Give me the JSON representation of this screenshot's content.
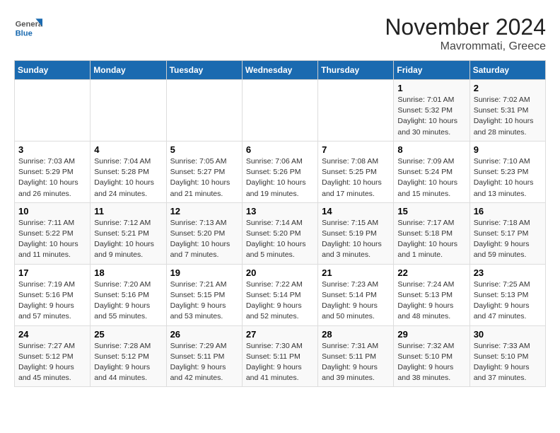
{
  "header": {
    "logo_line1": "General",
    "logo_line2": "Blue",
    "title": "November 2024",
    "subtitle": "Mavrommati, Greece"
  },
  "weekdays": [
    "Sunday",
    "Monday",
    "Tuesday",
    "Wednesday",
    "Thursday",
    "Friday",
    "Saturday"
  ],
  "weeks": [
    [
      {
        "day": "",
        "info": ""
      },
      {
        "day": "",
        "info": ""
      },
      {
        "day": "",
        "info": ""
      },
      {
        "day": "",
        "info": ""
      },
      {
        "day": "",
        "info": ""
      },
      {
        "day": "1",
        "info": "Sunrise: 7:01 AM\nSunset: 5:32 PM\nDaylight: 10 hours\nand 30 minutes."
      },
      {
        "day": "2",
        "info": "Sunrise: 7:02 AM\nSunset: 5:31 PM\nDaylight: 10 hours\nand 28 minutes."
      }
    ],
    [
      {
        "day": "3",
        "info": "Sunrise: 7:03 AM\nSunset: 5:29 PM\nDaylight: 10 hours\nand 26 minutes."
      },
      {
        "day": "4",
        "info": "Sunrise: 7:04 AM\nSunset: 5:28 PM\nDaylight: 10 hours\nand 24 minutes."
      },
      {
        "day": "5",
        "info": "Sunrise: 7:05 AM\nSunset: 5:27 PM\nDaylight: 10 hours\nand 21 minutes."
      },
      {
        "day": "6",
        "info": "Sunrise: 7:06 AM\nSunset: 5:26 PM\nDaylight: 10 hours\nand 19 minutes."
      },
      {
        "day": "7",
        "info": "Sunrise: 7:08 AM\nSunset: 5:25 PM\nDaylight: 10 hours\nand 17 minutes."
      },
      {
        "day": "8",
        "info": "Sunrise: 7:09 AM\nSunset: 5:24 PM\nDaylight: 10 hours\nand 15 minutes."
      },
      {
        "day": "9",
        "info": "Sunrise: 7:10 AM\nSunset: 5:23 PM\nDaylight: 10 hours\nand 13 minutes."
      }
    ],
    [
      {
        "day": "10",
        "info": "Sunrise: 7:11 AM\nSunset: 5:22 PM\nDaylight: 10 hours\nand 11 minutes."
      },
      {
        "day": "11",
        "info": "Sunrise: 7:12 AM\nSunset: 5:21 PM\nDaylight: 10 hours\nand 9 minutes."
      },
      {
        "day": "12",
        "info": "Sunrise: 7:13 AM\nSunset: 5:20 PM\nDaylight: 10 hours\nand 7 minutes."
      },
      {
        "day": "13",
        "info": "Sunrise: 7:14 AM\nSunset: 5:20 PM\nDaylight: 10 hours\nand 5 minutes."
      },
      {
        "day": "14",
        "info": "Sunrise: 7:15 AM\nSunset: 5:19 PM\nDaylight: 10 hours\nand 3 minutes."
      },
      {
        "day": "15",
        "info": "Sunrise: 7:17 AM\nSunset: 5:18 PM\nDaylight: 10 hours\nand 1 minute."
      },
      {
        "day": "16",
        "info": "Sunrise: 7:18 AM\nSunset: 5:17 PM\nDaylight: 9 hours\nand 59 minutes."
      }
    ],
    [
      {
        "day": "17",
        "info": "Sunrise: 7:19 AM\nSunset: 5:16 PM\nDaylight: 9 hours\nand 57 minutes."
      },
      {
        "day": "18",
        "info": "Sunrise: 7:20 AM\nSunset: 5:16 PM\nDaylight: 9 hours\nand 55 minutes."
      },
      {
        "day": "19",
        "info": "Sunrise: 7:21 AM\nSunset: 5:15 PM\nDaylight: 9 hours\nand 53 minutes."
      },
      {
        "day": "20",
        "info": "Sunrise: 7:22 AM\nSunset: 5:14 PM\nDaylight: 9 hours\nand 52 minutes."
      },
      {
        "day": "21",
        "info": "Sunrise: 7:23 AM\nSunset: 5:14 PM\nDaylight: 9 hours\nand 50 minutes."
      },
      {
        "day": "22",
        "info": "Sunrise: 7:24 AM\nSunset: 5:13 PM\nDaylight: 9 hours\nand 48 minutes."
      },
      {
        "day": "23",
        "info": "Sunrise: 7:25 AM\nSunset: 5:13 PM\nDaylight: 9 hours\nand 47 minutes."
      }
    ],
    [
      {
        "day": "24",
        "info": "Sunrise: 7:27 AM\nSunset: 5:12 PM\nDaylight: 9 hours\nand 45 minutes."
      },
      {
        "day": "25",
        "info": "Sunrise: 7:28 AM\nSunset: 5:12 PM\nDaylight: 9 hours\nand 44 minutes."
      },
      {
        "day": "26",
        "info": "Sunrise: 7:29 AM\nSunset: 5:11 PM\nDaylight: 9 hours\nand 42 minutes."
      },
      {
        "day": "27",
        "info": "Sunrise: 7:30 AM\nSunset: 5:11 PM\nDaylight: 9 hours\nand 41 minutes."
      },
      {
        "day": "28",
        "info": "Sunrise: 7:31 AM\nSunset: 5:11 PM\nDaylight: 9 hours\nand 39 minutes."
      },
      {
        "day": "29",
        "info": "Sunrise: 7:32 AM\nSunset: 5:10 PM\nDaylight: 9 hours\nand 38 minutes."
      },
      {
        "day": "30",
        "info": "Sunrise: 7:33 AM\nSunset: 5:10 PM\nDaylight: 9 hours\nand 37 minutes."
      }
    ]
  ]
}
